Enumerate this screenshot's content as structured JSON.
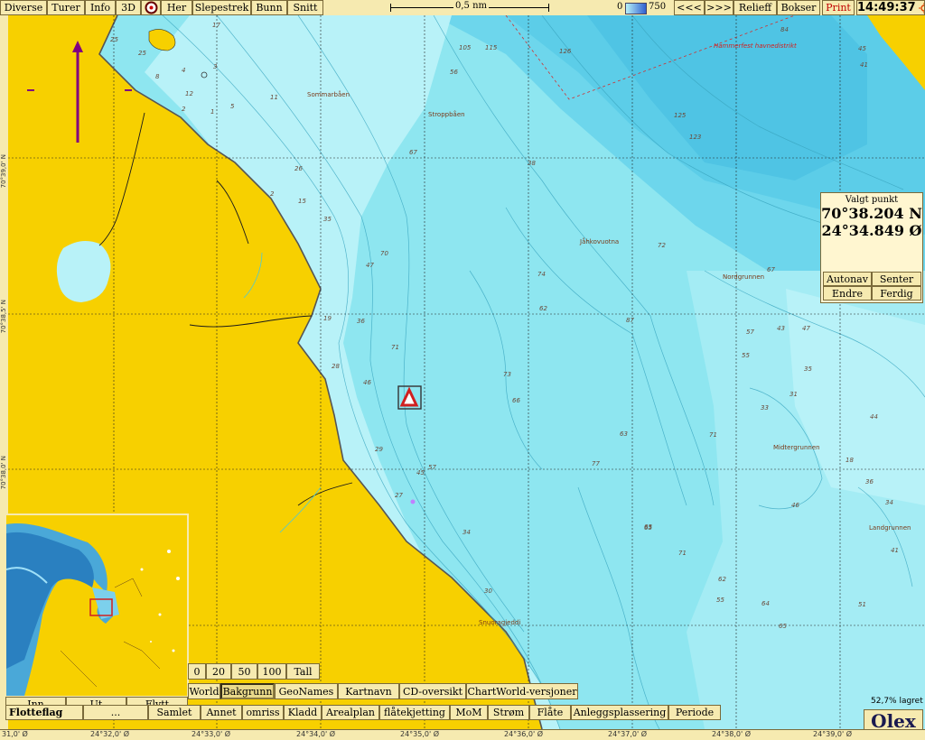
{
  "topbar": {
    "menu": [
      "Diverse",
      "Turer",
      "Info",
      "3D"
    ],
    "her_label": "Her",
    "menu2": [
      "Slepestrek",
      "Bunn",
      "Snitt"
    ],
    "scale_label": "0,5 nm",
    "depth_min": "0",
    "depth_max": "750",
    "prev_label": "<<<",
    "next_label": ">>>",
    "relieff_label": "Relieff",
    "bokser_label": "Bokser",
    "print_label": "Print",
    "time": "14:49:37"
  },
  "position_panel": {
    "title": "Valgt punkt",
    "lat": "70°38.204 N",
    "lon": "24°34.849 Ø",
    "buttons": [
      "Autonav",
      "Senter",
      "Endre",
      "Ferdig"
    ]
  },
  "inset": {
    "buttons": [
      "Inn",
      "Ut",
      "Flytt"
    ]
  },
  "scale_buttons": [
    "0",
    "20",
    "50",
    "100",
    "Tall"
  ],
  "layer_buttons": [
    "World",
    "Bakgrunn",
    "GeoNames",
    "Kartnavn",
    "CD-oversikt",
    "ChartWorld-versjoner"
  ],
  "layer_active": "Bakgrunn",
  "bottom_buttons": [
    "Flotteflag",
    "...",
    "Samlet",
    "Annet",
    "omriss",
    "Kladd",
    "Arealplan",
    "flåtekjetting",
    "MoM",
    "Strøm",
    "Flåte",
    "Anleggsplassering",
    "Periode"
  ],
  "save_status": "52,7% lagret",
  "brand": "Olex",
  "lon_ticks": [
    "31,0' Ø",
    "24°32,0' Ø",
    "24°33,0' Ø",
    "24°34,0' Ø",
    "24°35,0' Ø",
    "24°36,0' Ø",
    "24°37,0' Ø",
    "24°38,0' Ø",
    "24°39,0' Ø"
  ],
  "lat_ticks": [
    "70°39,0' N",
    "70°38,5' N",
    "70°38,0' N"
  ],
  "place_names": [
    "Sommarbåen",
    "Stroppbåen",
    "Jåhkovuotna",
    "Nordgrunnen",
    "Midtergrunnen",
    "Landgrunnen",
    "Snuoragjeddi",
    "Hammerfest havnedistrikt"
  ],
  "depth_soundings": [
    "105",
    "115",
    "126",
    "125",
    "123",
    "84",
    "45",
    "41",
    "67",
    "72",
    "74",
    "62",
    "67",
    "57",
    "43",
    "47",
    "87",
    "35",
    "31",
    "33",
    "44",
    "46",
    "71",
    "77",
    "65",
    "71",
    "62",
    "55",
    "64",
    "51",
    "36",
    "47",
    "70",
    "71",
    "73",
    "66",
    "63",
    "46",
    "28",
    "36",
    "19",
    "29",
    "27",
    "30",
    "45",
    "57",
    "56",
    "25",
    "26",
    "35",
    "15",
    "11",
    "8",
    "4",
    "3",
    "12",
    "2",
    "2",
    "25",
    "5",
    "1",
    "17",
    "38",
    "65",
    "34",
    "41",
    "34",
    "55",
    "65",
    "18"
  ],
  "colors": {
    "land": "#f7d000",
    "shallow": "#b8f2f8",
    "medium": "#8ee6f0",
    "deep": "#6dd6ec",
    "deepest": "#4fc4e4",
    "panel": "#f6eab0",
    "print_text": "#c00000",
    "marker": "#d02020",
    "route": "#800080"
  },
  "icons": [
    "compass-icon",
    "alarm-sun-icon",
    "waypoint-triangle-icon",
    "route-arrow-icon"
  ]
}
